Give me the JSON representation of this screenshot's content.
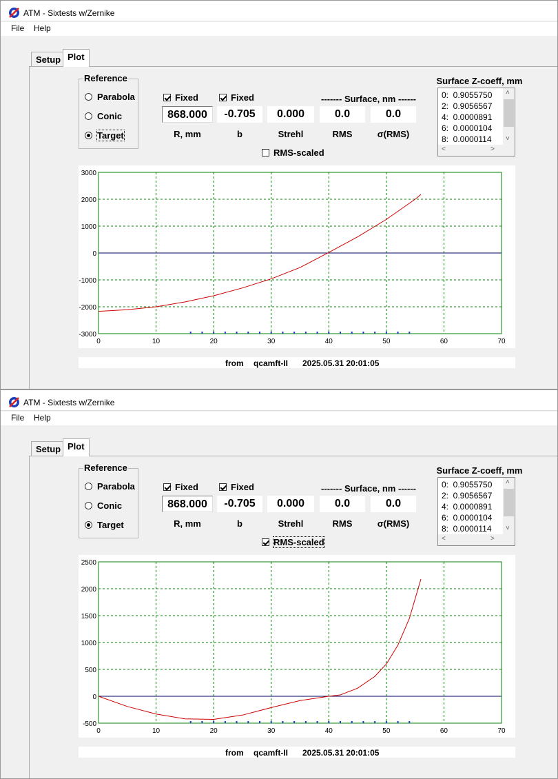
{
  "windows": [
    {
      "title": "ATM - Sixtests w/Zernike",
      "menu": [
        "File",
        "Help"
      ],
      "tabs": [
        "Setup",
        "Plot"
      ],
      "reference": {
        "title": "Reference",
        "options": [
          "Parabola",
          "Conic",
          "Target"
        ],
        "selected": "Target"
      },
      "fixed_r_label": "Fixed",
      "fixed_b_label": "Fixed",
      "surface_header": "------- Surface, nm ------",
      "fields": {
        "r": {
          "value": "868.000",
          "label": "R, mm"
        },
        "b": {
          "value": "-0.705",
          "label": "b"
        },
        "strehl": {
          "value": "0.000",
          "label": "Strehl"
        },
        "rms": {
          "value": "0.0",
          "label": "RMS"
        },
        "sigma_rms": {
          "value": "0.0",
          "label": "σ(RMS)"
        }
      },
      "rms_scaled": {
        "label": "RMS-scaled",
        "checked": false
      },
      "zcoeff": {
        "title": "Surface Z-coeff, mm",
        "items": [
          "0:  0.9055750",
          "2:  0.9056567",
          "4:  0.0000891",
          "6:  0.0000104",
          "8:  0.0000114"
        ]
      },
      "footer": {
        "from": "from",
        "source": "qcamft-II",
        "timestamp": "2025.05.31 20:01:05"
      },
      "chart_data": {
        "type": "line",
        "title": "",
        "xlabel": "",
        "ylabel": "",
        "xlim": [
          0,
          70
        ],
        "ylim": [
          -3000,
          3000
        ],
        "x_ticks": [
          "0",
          "10",
          "20",
          "30",
          "40",
          "50",
          "60",
          "70"
        ],
        "y_ticks": [
          "3000",
          "2000",
          "1000",
          "0",
          "-1000",
          "-2000",
          "-3000"
        ],
        "grid": true,
        "zero_line": true,
        "series": [
          {
            "x": [
              0,
              5,
              10,
              15,
              20,
              25,
              30,
              35,
              40,
              45,
              50,
              55,
              56
            ],
            "y": [
              -2170,
              -2110,
              -2000,
              -1820,
              -1590,
              -1300,
              -960,
              -540,
              20,
              600,
              1250,
              2000,
              2180
            ]
          }
        ],
        "zone_marks_x": [
          16,
          18,
          20,
          22,
          24,
          26,
          28,
          30,
          32,
          34,
          36,
          38,
          40,
          42,
          44,
          46,
          48,
          50,
          52,
          54
        ]
      }
    },
    {
      "title": "ATM - Sixtests w/Zernike",
      "menu": [
        "File",
        "Help"
      ],
      "tabs": [
        "Setup",
        "Plot"
      ],
      "reference": {
        "title": "Reference",
        "options": [
          "Parabola",
          "Conic",
          "Target"
        ],
        "selected": "Target"
      },
      "fixed_r_label": "Fixed",
      "fixed_b_label": "Fixed",
      "surface_header": "------- Surface, nm ------",
      "fields": {
        "r": {
          "value": "868.000",
          "label": "R, mm"
        },
        "b": {
          "value": "-0.705",
          "label": "b"
        },
        "strehl": {
          "value": "0.000",
          "label": "Strehl"
        },
        "rms": {
          "value": "0.0",
          "label": "RMS"
        },
        "sigma_rms": {
          "value": "0.0",
          "label": "σ(RMS)"
        }
      },
      "rms_scaled": {
        "label": "RMS-scaled",
        "checked": true
      },
      "zcoeff": {
        "title": "Surface Z-coeff, mm",
        "items": [
          "0:  0.9055750",
          "2:  0.9056567",
          "4:  0.0000891",
          "6:  0.0000104",
          "8:  0.0000114"
        ]
      },
      "footer": {
        "from": "from",
        "source": "qcamft-II",
        "timestamp": "2025.05.31 20:01:05"
      },
      "chart_data": {
        "type": "line",
        "title": "",
        "xlabel": "",
        "ylabel": "",
        "xlim": [
          0,
          70
        ],
        "ylim": [
          -500,
          2500
        ],
        "x_ticks": [
          "0",
          "10",
          "20",
          "30",
          "40",
          "50",
          "60",
          "70"
        ],
        "y_ticks": [
          "2500",
          "2000",
          "1500",
          "1000",
          "500",
          "0",
          "-500"
        ],
        "grid": true,
        "zero_line": true,
        "series": [
          {
            "x": [
              0,
              5,
              10,
              15,
              20,
              25,
              30,
              35,
              40,
              42,
              45,
              48,
              50,
              52,
              54,
              56
            ],
            "y": [
              0,
              -190,
              -330,
              -420,
              -430,
              -350,
              -210,
              -80,
              0,
              25,
              150,
              370,
              600,
              950,
              1450,
              2180
            ]
          }
        ],
        "zone_marks_x": [
          16,
          18,
          20,
          22,
          24,
          26,
          28,
          30,
          32,
          34,
          36,
          38,
          40,
          42,
          44,
          46,
          48,
          50,
          52,
          54
        ]
      }
    }
  ]
}
